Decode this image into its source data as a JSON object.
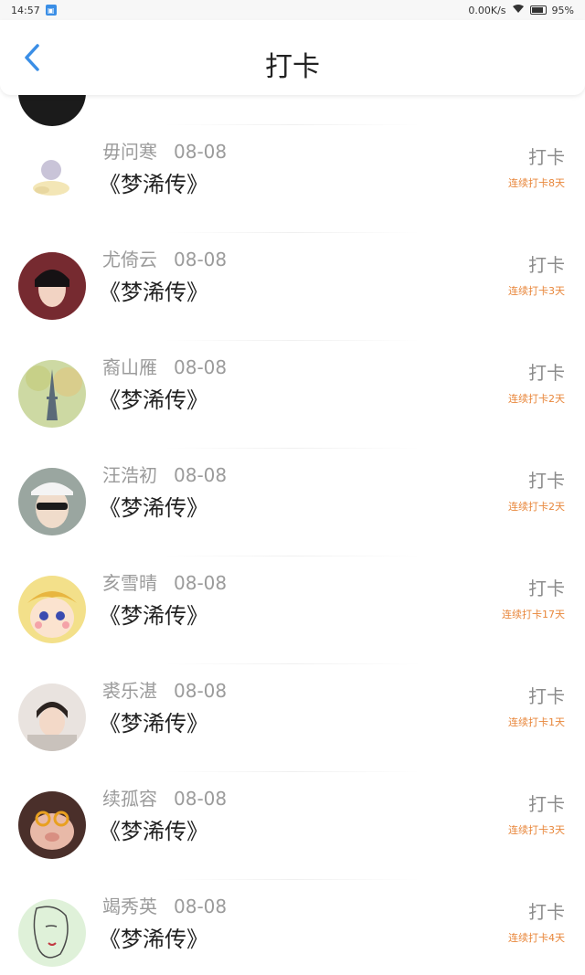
{
  "status": {
    "time": "14:57",
    "speed": "0.00K/s",
    "battery": "95%"
  },
  "header": {
    "title": "打卡"
  },
  "items": [
    {
      "name": "毋问寒",
      "date": "08-08",
      "book": "《梦浠传》",
      "action": "打卡",
      "streak": "连续打卡8天"
    },
    {
      "name": "尤倚云",
      "date": "08-08",
      "book": "《梦浠传》",
      "action": "打卡",
      "streak": "连续打卡3天"
    },
    {
      "name": "裔山雁",
      "date": "08-08",
      "book": "《梦浠传》",
      "action": "打卡",
      "streak": "连续打卡2天"
    },
    {
      "name": "汪浩初",
      "date": "08-08",
      "book": "《梦浠传》",
      "action": "打卡",
      "streak": "连续打卡2天"
    },
    {
      "name": "亥雪晴",
      "date": "08-08",
      "book": "《梦浠传》",
      "action": "打卡",
      "streak": "连续打卡17天"
    },
    {
      "name": "裘乐湛",
      "date": "08-08",
      "book": "《梦浠传》",
      "action": "打卡",
      "streak": "连续打卡1天"
    },
    {
      "name": "续孤容",
      "date": "08-08",
      "book": "《梦浠传》",
      "action": "打卡",
      "streak": "连续打卡3天"
    },
    {
      "name": "竭秀英",
      "date": "08-08",
      "book": "《梦浠传》",
      "action": "打卡",
      "streak": "连续打卡4天"
    }
  ],
  "colors": {
    "accent": "#3a8ee6",
    "streak": "#e8863a"
  }
}
